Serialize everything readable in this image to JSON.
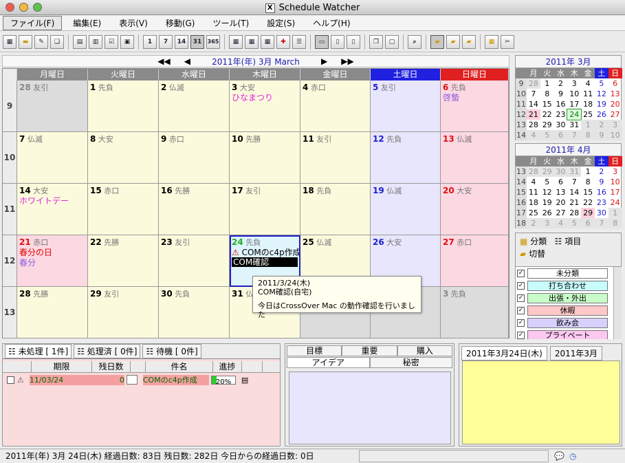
{
  "window": {
    "title": "Schedule Watcher"
  },
  "menu": [
    "ファイル(F)",
    "編集(E)",
    "表示(V)",
    "移動(G)",
    "ツール(T)",
    "設定(S)",
    "ヘルプ(H)"
  ],
  "toolbar": {
    "day_buttons": [
      "1",
      "7",
      "14",
      "31",
      "365"
    ]
  },
  "nav": {
    "month_label": "2011年(年) 3月 March",
    "prev_year": "◀◀",
    "prev": "◀",
    "next": "▶",
    "next_year": "▶▶"
  },
  "calendar": {
    "day_headers": [
      "月曜日",
      "火曜日",
      "水曜日",
      "木曜日",
      "金曜日",
      "土曜日",
      "日曜日"
    ],
    "weeks": [
      {
        "num": "9",
        "days": [
          {
            "d": "28",
            "r": "友引",
            "kind": "gray"
          },
          {
            "d": "1",
            "r": "先負"
          },
          {
            "d": "2",
            "r": "仏滅"
          },
          {
            "d": "3",
            "r": "大安",
            "events": [
              {
                "t": "ひなまつり",
                "c": "mag"
              }
            ]
          },
          {
            "d": "4",
            "r": "赤口"
          },
          {
            "d": "5",
            "r": "友引",
            "kind": "sat"
          },
          {
            "d": "6",
            "r": "先負",
            "kind": "sun",
            "events": [
              {
                "t": "啓蟄",
                "c": "pur"
              }
            ]
          }
        ]
      },
      {
        "num": "10",
        "days": [
          {
            "d": "7",
            "r": "仏滅"
          },
          {
            "d": "8",
            "r": "大安"
          },
          {
            "d": "9",
            "r": "赤口"
          },
          {
            "d": "10",
            "r": "先勝"
          },
          {
            "d": "11",
            "r": "友引"
          },
          {
            "d": "12",
            "r": "先負",
            "kind": "sat"
          },
          {
            "d": "13",
            "r": "仏滅",
            "kind": "sun"
          }
        ]
      },
      {
        "num": "11",
        "days": [
          {
            "d": "14",
            "r": "大安",
            "events": [
              {
                "t": "ホワイトデー",
                "c": "mag"
              }
            ]
          },
          {
            "d": "15",
            "r": "赤口"
          },
          {
            "d": "16",
            "r": "先勝"
          },
          {
            "d": "17",
            "r": "友引"
          },
          {
            "d": "18",
            "r": "先負"
          },
          {
            "d": "19",
            "r": "仏滅",
            "kind": "sat"
          },
          {
            "d": "20",
            "r": "大安",
            "kind": "sun"
          }
        ]
      },
      {
        "num": "12",
        "days": [
          {
            "d": "21",
            "r": "赤口",
            "kind": "hol",
            "events": [
              {
                "t": "春分の日",
                "c": "red"
              },
              {
                "t": "春分",
                "c": "pur"
              }
            ]
          },
          {
            "d": "22",
            "r": "先勝"
          },
          {
            "d": "23",
            "r": "友引"
          },
          {
            "d": "24",
            "r": "先負",
            "kind": "today",
            "bars": [
              {
                "t": "COMのc4p作成",
                "style": "warn"
              },
              {
                "t": "COM確認",
                "style": "dark"
              }
            ]
          },
          {
            "d": "25",
            "r": "仏滅"
          },
          {
            "d": "26",
            "r": "大安",
            "kind": "sat"
          },
          {
            "d": "27",
            "r": "赤口",
            "kind": "sun"
          }
        ]
      },
      {
        "num": "13",
        "days": [
          {
            "d": "28",
            "r": "先勝"
          },
          {
            "d": "29",
            "r": "友引"
          },
          {
            "d": "30",
            "r": "先負"
          },
          {
            "d": "31",
            "r": "仏滅"
          },
          {
            "d": "",
            "r": "",
            "kind": "gray"
          },
          {
            "d": "",
            "r": "",
            "kind": "gray"
          },
          {
            "d": "3",
            "r": "先負",
            "kind": "gray"
          }
        ]
      }
    ]
  },
  "tooltip": {
    "line1": "2011/3/24(木)",
    "line2": "COM確認(自宅)",
    "line3": "今日はCrossOver Mac の動作確認を行いました"
  },
  "minical_march": {
    "title": "2011年 3月",
    "headers": [
      "月",
      "火",
      "水",
      "木",
      "金",
      "土",
      "日"
    ],
    "rows": [
      [
        "9",
        "28",
        "1",
        "2",
        "3",
        "4",
        "5",
        "6"
      ],
      [
        "10",
        "7",
        "8",
        "9",
        "10",
        "11",
        "12",
        "13"
      ],
      [
        "11",
        "14",
        "15",
        "16",
        "17",
        "18",
        "19",
        "20"
      ],
      [
        "12",
        "21",
        "22",
        "23",
        "24",
        "25",
        "26",
        "27"
      ],
      [
        "13",
        "28",
        "29",
        "30",
        "31",
        "1",
        "2",
        "3"
      ],
      [
        "14",
        "4",
        "5",
        "6",
        "7",
        "8",
        "9",
        "10"
      ]
    ]
  },
  "minical_april": {
    "title": "2011年 4月",
    "headers": [
      "月",
      "火",
      "水",
      "木",
      "金",
      "土",
      "日"
    ],
    "rows": [
      [
        "13",
        "28",
        "29",
        "30",
        "31",
        "1",
        "2",
        "3"
      ],
      [
        "14",
        "4",
        "5",
        "6",
        "7",
        "8",
        "9",
        "10"
      ],
      [
        "15",
        "11",
        "12",
        "13",
        "14",
        "15",
        "16",
        "17"
      ],
      [
        "16",
        "18",
        "19",
        "20",
        "21",
        "22",
        "23",
        "24"
      ],
      [
        "17",
        "25",
        "26",
        "27",
        "28",
        "29",
        "30",
        "1"
      ],
      [
        "18",
        "2",
        "3",
        "4",
        "5",
        "6",
        "7",
        "8"
      ]
    ]
  },
  "categories": {
    "tab_bunrui": "分類",
    "tab_koumoku": "項目",
    "switch": "切替",
    "items": [
      {
        "label": "未分類",
        "color": "#ffffff"
      },
      {
        "label": "打ち合わせ",
        "color": "#c8fcfc"
      },
      {
        "label": "出張・外出",
        "color": "#c8fcc8"
      },
      {
        "label": "休暇",
        "color": "#fcc8c8"
      },
      {
        "label": "飲み会",
        "color": "#d8d0fc"
      },
      {
        "label": "プライベート",
        "color": "#fcc8f0"
      }
    ]
  },
  "tasks": {
    "tabs": [
      "未処理 [ 1件]",
      "処理済 [ 0件]",
      "待機 [ 0件]"
    ],
    "headers": [
      "期限",
      "残日数",
      "件名",
      "進捗"
    ],
    "row": {
      "due": "11/03/24",
      "remaining": "0",
      "subject": "COMのc4p作成",
      "progress": "20%"
    }
  },
  "memo": {
    "tabs_row1": [
      "目標",
      "重要",
      "購入"
    ],
    "tabs_row2": [
      "アイデア",
      "秘密"
    ]
  },
  "daynote": {
    "tabs": [
      "2011年3月24日(木)",
      "2011年3月"
    ]
  },
  "status": {
    "text": "2011年(年) 3月 24日(木) 経過日数: 83日 残日数: 282日 今日からの経過日数: 0日"
  }
}
